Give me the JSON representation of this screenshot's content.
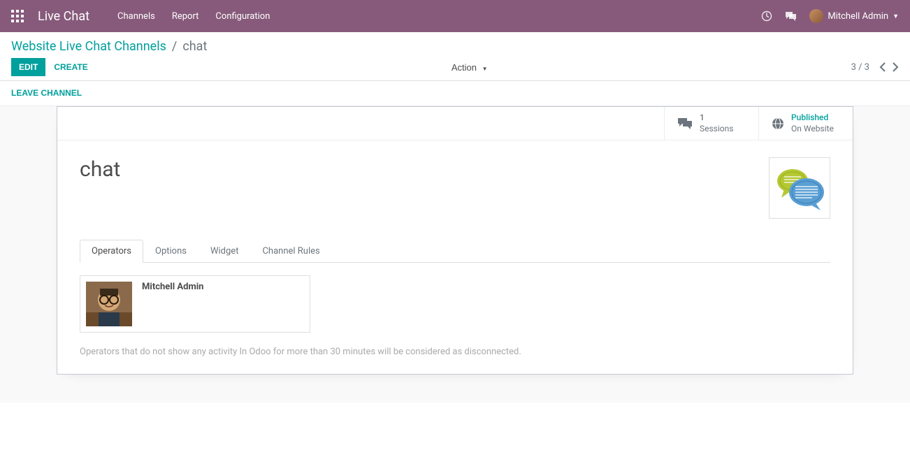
{
  "navbar": {
    "brand": "Live Chat",
    "menu": [
      "Channels",
      "Report",
      "Configuration"
    ],
    "user": "Mitchell Admin"
  },
  "breadcrumb": {
    "parent": "Website Live Chat Channels",
    "current": "chat"
  },
  "buttons": {
    "edit": "Edit",
    "create": "Create",
    "action": "Action",
    "leave": "Leave Channel"
  },
  "pager": {
    "text": "3 / 3"
  },
  "stats": {
    "sessions_count": "1",
    "sessions_label": "Sessions",
    "published_value": "Published",
    "published_label": "On Website"
  },
  "record": {
    "title": "chat"
  },
  "tabs": [
    "Operators",
    "Options",
    "Widget",
    "Channel Rules"
  ],
  "operators": [
    {
      "name": "Mitchell Admin"
    }
  ],
  "help": "Operators that do not show any activity In Odoo for more than 30 minutes will be considered as disconnected."
}
